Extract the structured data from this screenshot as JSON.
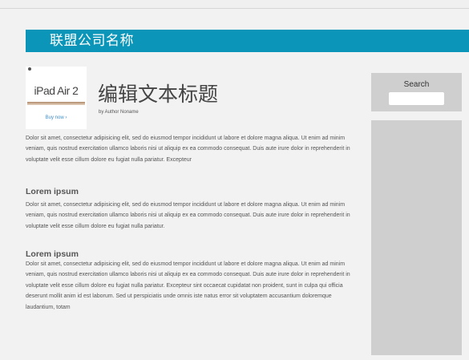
{
  "header": {
    "company_name": "联盟公司名称"
  },
  "promo": {
    "product": "iPad Air 2",
    "buy_label": "Buy now ›"
  },
  "article": {
    "title": "编辑文本标题",
    "byline": "by Author Noname",
    "intro": "Dolor sit amet, consectetur adipisicing elit, sed do eiusmod tempor incididunt ut labore et dolore magna aliqua. Ut enim ad minim veniam, quis nostrud exercitation ullamco laboris nisi ut aliquip ex ea commodo consequat. Duis aute irure dolor in reprehenderit in voluptate velit esse cillum dolore eu fugiat nulla pariatur. Excepteur",
    "sections": [
      {
        "heading": "Lorem ipsum",
        "body": "Dolor sit amet, consectetur adipisicing elit, sed do eiusmod tempor incididunt ut labore et dolore magna aliqua. Ut enim ad minim veniam, quis nostrud exercitation ullamco laboris nisi ut aliquip ex ea commodo consequat. Duis aute irure dolor in reprehenderit in voluptate velit esse cillum dolore eu fugiat nulla pariatur."
      },
      {
        "heading": "Lorem ipsum",
        "body": "Dolor sit amet, consectetur adipisicing elit, sed do eiusmod tempor incididunt ut labore et dolore magna aliqua. Ut enim ad minim veniam, quis nostrud exercitation ullamco laboris nisi ut aliquip ex ea commodo consequat. Duis aute irure dolor in reprehenderit in voluptate velit esse cillum dolore eu fugiat nulla pariatur. Excepteur sint occaecat cupidatat non proident, sunt in culpa qui officia deserunt mollit anim id est laborum. Sed ut perspiciatis unde omnis iste natus error sit voluptatem accusantium doloremque laudantium, totam"
      }
    ]
  },
  "sidebar": {
    "search_label": "Search",
    "search_value": ""
  },
  "colors": {
    "banner": "#0b95b8",
    "sidebar": "#cfcfcf",
    "background": "#f2f2f2"
  }
}
